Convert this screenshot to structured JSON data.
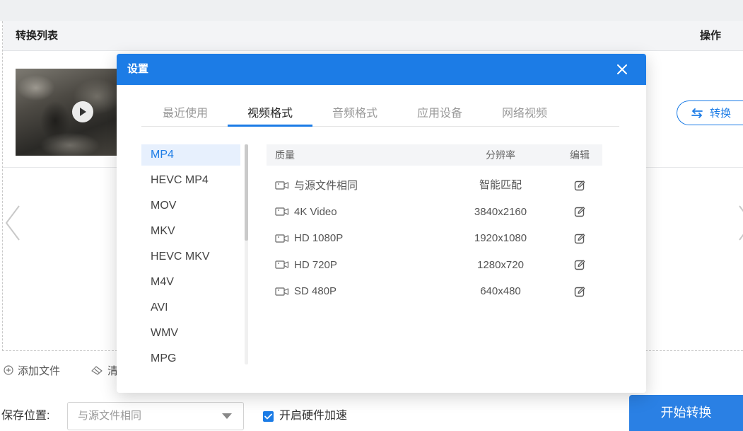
{
  "window": {
    "list_header": {
      "title": "转换列表",
      "actions_label": "操作"
    },
    "file_item": {
      "thumbnail_icon": "play-icon",
      "convert_button": {
        "label": "转换",
        "icon": "swap-icon"
      }
    },
    "navigation": {
      "prev_icon": "chevron-left-icon",
      "next_icon": "chevron-right-icon"
    },
    "list_actions": {
      "add_file": {
        "label": "添加文件",
        "icon": "plus-circle-icon"
      },
      "clear": {
        "label": "清",
        "icon": "eraser-icon"
      }
    },
    "bottom_bar": {
      "save_location_label": "保存位置:",
      "save_location_select": {
        "value": "与源文件相同",
        "icon": "caret-down-icon"
      },
      "hardware_acceleration": {
        "label": "开启硬件加速",
        "checked": true
      },
      "start_button": {
        "label": "开始转换"
      }
    }
  },
  "settings_dialog": {
    "title": "设置",
    "close_icon": "close-icon",
    "tabs": [
      {
        "label": "最近使用",
        "active": false
      },
      {
        "label": "视频格式",
        "active": true
      },
      {
        "label": "音频格式",
        "active": false
      },
      {
        "label": "应用设备",
        "active": false
      },
      {
        "label": "网络视频",
        "active": false
      }
    ],
    "formats": [
      {
        "label": "MP4",
        "selected": true
      },
      {
        "label": "HEVC MP4",
        "selected": false
      },
      {
        "label": "MOV",
        "selected": false
      },
      {
        "label": "MKV",
        "selected": false
      },
      {
        "label": "HEVC MKV",
        "selected": false
      },
      {
        "label": "M4V",
        "selected": false
      },
      {
        "label": "AVI",
        "selected": false
      },
      {
        "label": "WMV",
        "selected": false
      },
      {
        "label": "MPG",
        "selected": false
      }
    ],
    "presets_table": {
      "headers": {
        "quality": "质量",
        "resolution": "分辨率",
        "edit": "编辑"
      },
      "rows": [
        {
          "quality": "与源文件相同",
          "resolution": "智能匹配",
          "icon": "video-camera-icon",
          "edit_icon": "edit-icon"
        },
        {
          "quality": "4K Video",
          "resolution": "3840x2160",
          "icon": "video-camera-icon",
          "edit_icon": "edit-icon"
        },
        {
          "quality": "HD 1080P",
          "resolution": "1920x1080",
          "icon": "video-camera-icon",
          "edit_icon": "edit-icon"
        },
        {
          "quality": "HD 720P",
          "resolution": "1280x720",
          "icon": "video-camera-icon",
          "edit_icon": "edit-icon"
        },
        {
          "quality": "SD 480P",
          "resolution": "640x480",
          "icon": "video-camera-icon",
          "edit_icon": "edit-icon"
        }
      ]
    }
  },
  "colors": {
    "accent": "#1c7ce6",
    "start_button": "#2a80e4",
    "selected_format_bg": "#e7f0fd"
  }
}
